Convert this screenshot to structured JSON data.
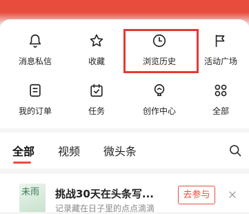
{
  "menu": {
    "row1": [
      {
        "label": "消息私信",
        "icon": "bell-icon"
      },
      {
        "label": "收藏",
        "icon": "star-icon"
      },
      {
        "label": "浏览历史",
        "icon": "clock-icon"
      },
      {
        "label": "活动广场",
        "icon": "flag-icon"
      }
    ],
    "row2": [
      {
        "label": "我的订单",
        "icon": "order-icon"
      },
      {
        "label": "任务",
        "icon": "calendar-check-icon"
      },
      {
        "label": "创作中心",
        "icon": "bulb-icon"
      },
      {
        "label": "全部",
        "icon": "grid-icon"
      }
    ]
  },
  "tabs": [
    "全部",
    "视频",
    "微头条"
  ],
  "promo": {
    "thumb_text": "未雨",
    "title": "挑战30天在头条写...",
    "subtitle": "记录藏在日子里的点点滴滴",
    "button": "去参与"
  },
  "colors": {
    "accent": "#e84c3d",
    "highlight": "#e53935"
  }
}
